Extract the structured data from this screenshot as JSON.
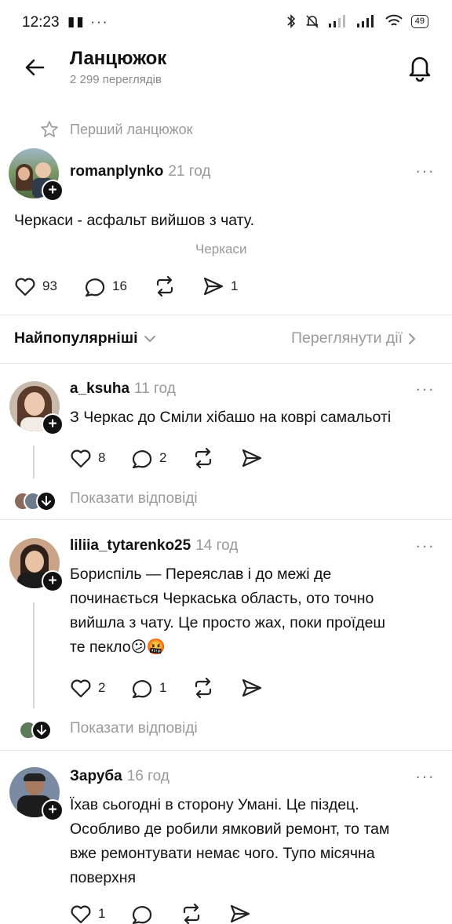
{
  "status_bar": {
    "time": "12:23",
    "left_icons": "▮▮ ···",
    "battery": "49"
  },
  "header": {
    "title": "Ланцюжок",
    "views": "2 299 переглядів"
  },
  "first_thread_label": "Перший ланцюжок",
  "post": {
    "username": "romanplynko",
    "time": "21 год",
    "text": "Черкаси - асфальт вийшов з чату.",
    "location_tag": "Черкаси",
    "likes": "93",
    "comments": "16",
    "shares": "1"
  },
  "sort": {
    "label": "Найпопулярніші",
    "activity_link": "Переглянути дії"
  },
  "replies": [
    {
      "username": "a_ksuha",
      "time": "11 год",
      "text": "З Черкас до Сміли хібашо на коврі самальоті",
      "likes": "8",
      "comments": "2",
      "show_replies": "Показати відповіді"
    },
    {
      "username": "liliia_tytarenko25",
      "time": "14 год",
      "text_lines": [
        "Бориспіль — Переяслав і до межі де",
        "починається Черкаська область, ото точно",
        "вийшла з чату. Це просто жах, поки проїдеш",
        "те пекло😕🤬"
      ],
      "likes": "2",
      "comments": "1",
      "show_replies": "Показати відповіді"
    },
    {
      "username": "Заруба",
      "time": "16 год",
      "text_lines": [
        "Їхав сьогодні в сторону Умані. Це піздец.",
        "Особливо де робили ямковий ремонт, то там",
        "вже ремонтувати немає чого. Тупо місячна",
        "поверхня"
      ],
      "likes": "1"
    }
  ],
  "colors": {
    "text": "#111111",
    "muted": "#999999",
    "divider": "#e6e6e6"
  }
}
